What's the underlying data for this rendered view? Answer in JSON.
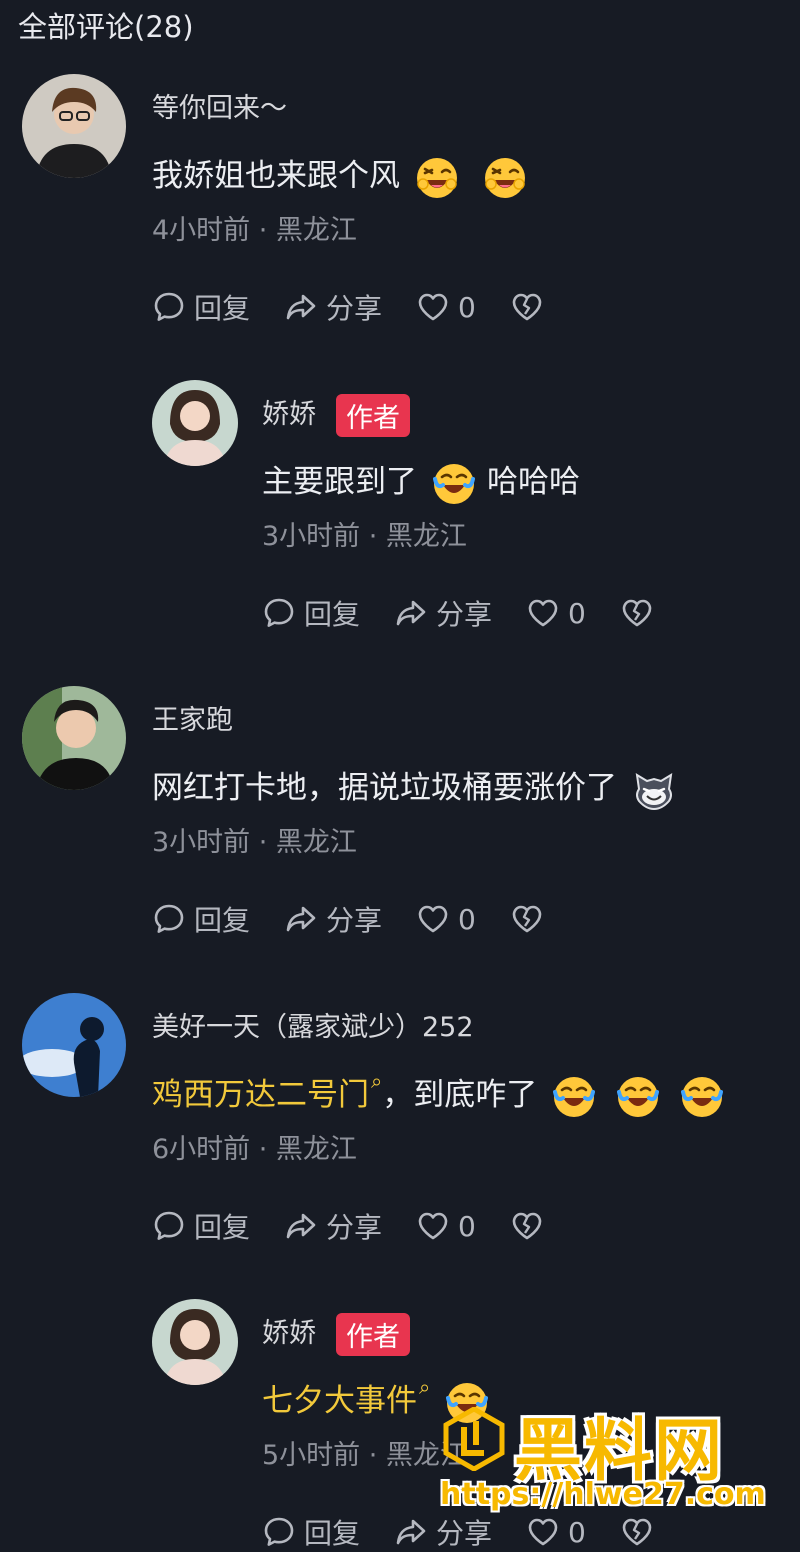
{
  "header": {
    "title": "全部评论(28)"
  },
  "comments": [
    {
      "name": "等你回来～",
      "text": "我娇姐也来跟个风",
      "time": "4小时前 · 黑龙江",
      "reply": "回复",
      "share": "分享",
      "likes": "0"
    },
    {
      "name": "娇娇",
      "badge": "作者",
      "text_a": "主要跟到了",
      "text_b": "哈哈哈",
      "time": "3小时前 · 黑龙江",
      "reply": "回复",
      "share": "分享",
      "likes": "0"
    },
    {
      "name": "王家跑",
      "text": "网红打卡地，据说垃圾桶要涨价了",
      "time": "3小时前 · 黑龙江",
      "reply": "回复",
      "share": "分享",
      "likes": "0"
    },
    {
      "name": "美好一天（露家斌少）252",
      "link": "鸡西万达二号门",
      "text": "，到底咋了",
      "time": "6小时前 · 黑龙江",
      "reply": "回复",
      "share": "分享",
      "likes": "0"
    },
    {
      "name": "娇娇",
      "badge": "作者",
      "link": "七夕大事件",
      "time": "5小时前 · 黑龙江",
      "reply": "回复",
      "share": "分享",
      "likes": "0"
    }
  ],
  "watermark": {
    "title": "黑料网",
    "url": "https://hlwe27.com"
  },
  "icons": {
    "reply": "comment-bubble-icon",
    "share": "share-arrow-icon",
    "like": "heart-icon",
    "dislike": "broken-heart-icon",
    "emoji_wink": "wink-laugh-emoji",
    "emoji_cry": "crying-laugh-emoji",
    "emoji_cat": "grinning-cat-emoji",
    "search": "search-icon"
  },
  "colors": {
    "background": "#171b24",
    "badge": "#e8354f",
    "link": "#f2c93b",
    "meta": "#8e919a"
  }
}
